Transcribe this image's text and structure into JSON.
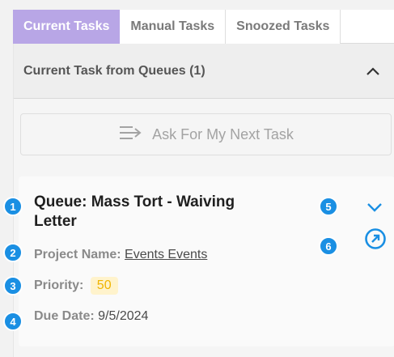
{
  "tabs": [
    {
      "label": "Current Tasks",
      "active": true
    },
    {
      "label": "Manual Tasks",
      "active": false
    },
    {
      "label": "Snoozed Tasks",
      "active": false
    }
  ],
  "section": {
    "title": "Current Task from Queues (1)",
    "collapse_icon": "chevron-up-icon"
  },
  "next_task_button": {
    "label": "Ask For My Next Task",
    "icon": "arrow-next-icon"
  },
  "task": {
    "queue_line1": "Queue: Mass Tort - Waiving",
    "queue_line2": "Letter",
    "project_label": "Project Name:",
    "project_value": "Events Events",
    "priority_label": "Priority:",
    "priority_value": "50",
    "due_label": "Due Date:",
    "due_value": "9/5/2024",
    "expand_icon": "chevron-down-icon",
    "open_icon": "open-task-icon"
  },
  "markers": [
    "1",
    "2",
    "3",
    "4",
    "5",
    "6"
  ],
  "colors": {
    "tab_active": "#b8a6e6",
    "marker": "#1a8fe3",
    "action_icon": "#1a8fe3",
    "priority_text": "#f0b400",
    "priority_bg": "#fff3cc"
  }
}
